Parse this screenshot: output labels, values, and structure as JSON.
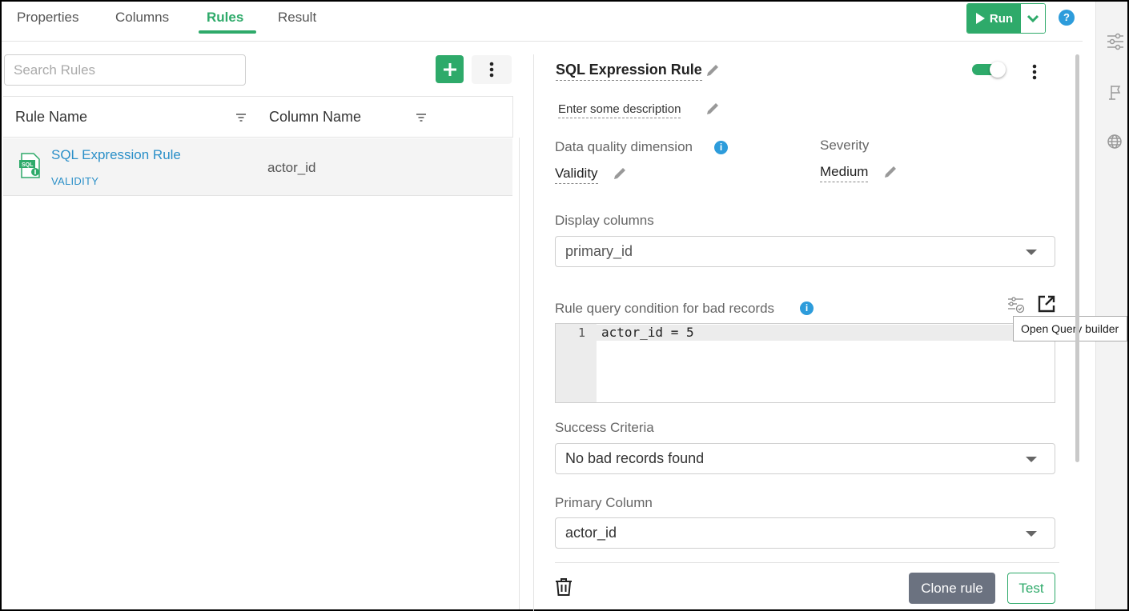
{
  "tabs": [
    {
      "label": "Properties"
    },
    {
      "label": "Columns"
    },
    {
      "label": "Rules",
      "active": true
    },
    {
      "label": "Result"
    }
  ],
  "toolbar": {
    "run_label": "Run",
    "help_label": "?"
  },
  "rail": {
    "icons": [
      "sliders-icon",
      "flag-icon",
      "globe-icon"
    ]
  },
  "left": {
    "search_placeholder": "Search Rules",
    "columns": [
      "Rule Name",
      "Column Name"
    ],
    "rules": [
      {
        "name": "SQL Expression Rule",
        "dimension": "VALIDITY",
        "column": "actor_id"
      }
    ]
  },
  "detail": {
    "title": "SQL Expression Rule",
    "enabled": true,
    "description": "Enter some description",
    "dq_dimension_label": "Data quality dimension",
    "dq_dimension_value": "Validity",
    "severity_label": "Severity",
    "severity_value": "Medium",
    "display_columns_label": "Display columns",
    "display_columns_value": "primary_id",
    "query_label": "Rule query condition for bad records",
    "query_lines": [
      {
        "num": "1",
        "code": "actor_id = 5"
      }
    ],
    "tooltip": "Open Query builder",
    "success_label": "Success Criteria",
    "success_value": "No bad records found",
    "primary_label": "Primary Column",
    "primary_value": "actor_id",
    "clone_label": "Clone rule",
    "test_label": "Test"
  },
  "colors": {
    "accent": "#2eaa6a",
    "link": "#2a8fc8",
    "info": "#2d9cdb"
  }
}
